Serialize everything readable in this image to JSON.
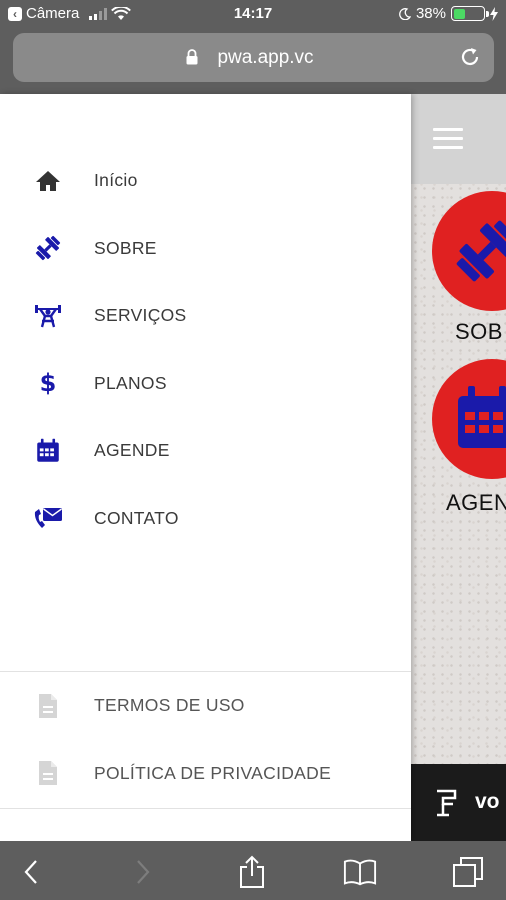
{
  "status_bar": {
    "back_app": "Câmera",
    "time": "14:17",
    "battery_percent": "38%",
    "battery_level": 0.38,
    "icons": [
      "back-chevron-icon",
      "signal-icon",
      "wifi-icon",
      "moon-icon",
      "battery-icon",
      "charging-icon"
    ]
  },
  "browser": {
    "url": "pwa.app.vc",
    "icons": [
      "lock-icon",
      "reload-icon"
    ]
  },
  "drawer": {
    "menu": [
      {
        "label": "Início",
        "icon": "home-icon",
        "color": "#333333"
      },
      {
        "label": "SOBRE",
        "icon": "dumbbell-icon",
        "color": "#1a1aaa"
      },
      {
        "label": "SERVIÇOS",
        "icon": "weightlifter-icon",
        "color": "#1a1aaa"
      },
      {
        "label": "PLANOS",
        "icon": "dollar-icon",
        "color": "#1a1aaa"
      },
      {
        "label": "AGENDE",
        "icon": "calendar-icon",
        "color": "#1a1aaa"
      },
      {
        "label": "CONTATO",
        "icon": "phone-mail-icon",
        "color": "#1a1aaa"
      }
    ],
    "legal": [
      {
        "label": "TERMOS DE USO",
        "icon": "document-icon"
      },
      {
        "label": "POLÍTICA DE PRIVACIDADE",
        "icon": "document-icon"
      }
    ]
  },
  "background_page": {
    "tiles": [
      {
        "label": "SOB",
        "icon": "dumbbell-icon"
      },
      {
        "label": "AGEN",
        "icon": "calendar-icon"
      }
    ],
    "footer_text": "vo",
    "accent_color": "#e02121"
  },
  "toolbar": {
    "icons": [
      "back-arrow-icon",
      "forward-arrow-icon",
      "share-icon",
      "bookmarks-icon",
      "tabs-icon"
    ]
  }
}
